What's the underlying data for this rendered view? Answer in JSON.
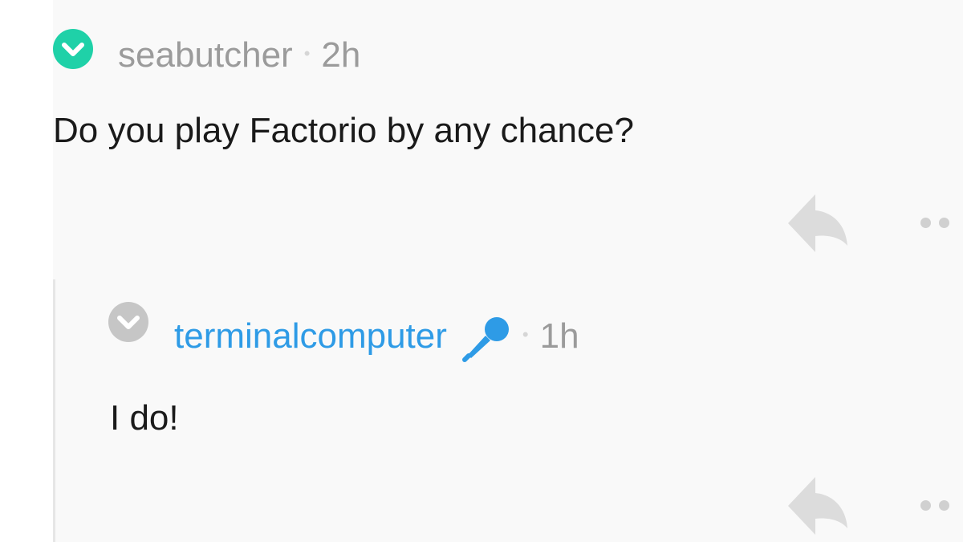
{
  "comments": [
    {
      "author": "seabutcher",
      "time": "2h",
      "body": "Do you play Factorio by any chance?",
      "collapse_icon": "chevron-down-circle-icon",
      "collapse_color": "#1fd1a8"
    },
    {
      "author": "terminalcomputer",
      "time": "1h",
      "body": "I do!",
      "collapse_icon": "chevron-down-circle-icon",
      "collapse_color": "#c6c6c6",
      "badge_icon": "microphone-icon",
      "author_color": "#2e9be6"
    }
  ],
  "separator": "•",
  "actions": {
    "reply_icon": "reply-arrow-icon",
    "more_icon": "more-dots-icon"
  }
}
